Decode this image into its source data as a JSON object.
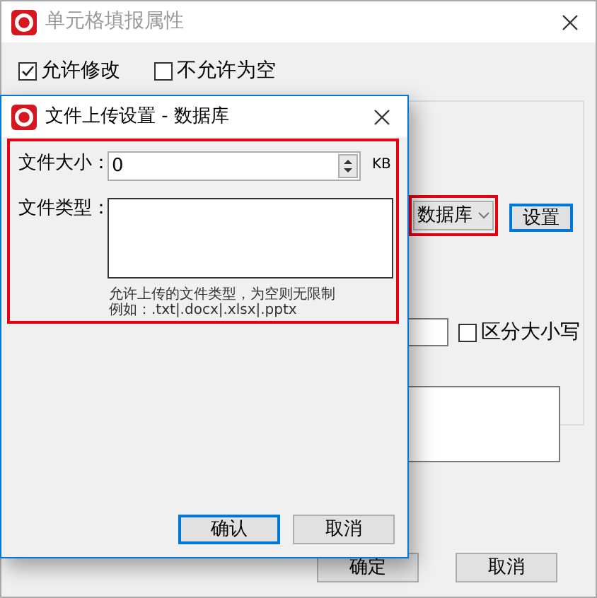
{
  "main_window": {
    "title": "单元格填报属性",
    "checkboxes": [
      {
        "label": "允许修改",
        "checked": true
      },
      {
        "label": "不允许为空",
        "checked": false
      }
    ],
    "source_select": {
      "value": "数据库",
      "highlighted": true
    },
    "settings_button": "设置",
    "case_checkbox": {
      "label": "区分大小写",
      "checked": false
    },
    "buttons": [
      {
        "label": "确定",
        "default": false
      },
      {
        "label": "取消",
        "default": false
      }
    ]
  },
  "dialog": {
    "title": "文件上传设置 - 数据库",
    "highlighted": true,
    "size_label": "文件大小：",
    "size_value": "0",
    "size_unit": "KB",
    "type_label": "文件类型：",
    "hint_lines": [
      "允许上传的文件类型，为空则无限制",
      "例如：.txt|.docx|.xlsx|.pptx"
    ],
    "buttons": [
      {
        "label": "确认",
        "default": true
      },
      {
        "label": "取消",
        "default": false
      }
    ]
  }
}
